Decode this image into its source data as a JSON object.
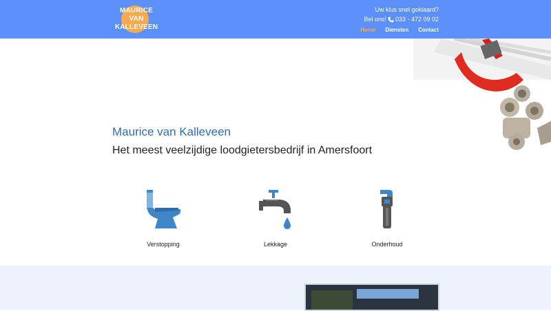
{
  "header": {
    "logo_lines": [
      "MAURICE",
      "VAN",
      "KALLEVEEN"
    ],
    "tagline": "Uw klus snel geklaard?",
    "phone_prefix": "Bel ons!",
    "phone_number": "033 - 472 09 02",
    "nav": [
      {
        "label": "Home",
        "active": true
      },
      {
        "label": "Diensten",
        "active": false
      },
      {
        "label": "Contact",
        "active": false
      }
    ]
  },
  "hero": {
    "title": "Maurice van Kalleveen",
    "subtitle": "Het meest veelzijdige loodgietersbedrijf in Amersfoort"
  },
  "services": [
    {
      "label": "Verstopping",
      "icon": "toilet-icon"
    },
    {
      "label": "Lekkage",
      "icon": "faucet-icon"
    },
    {
      "label": "Onderhoud",
      "icon": "wrench-icon"
    }
  ],
  "colors": {
    "header": "#5b8ff9",
    "accent_orange": "#f7a94f",
    "title_blue": "#2f6dad",
    "icon_blue": "#3f86c6",
    "icon_grey": "#555555"
  }
}
